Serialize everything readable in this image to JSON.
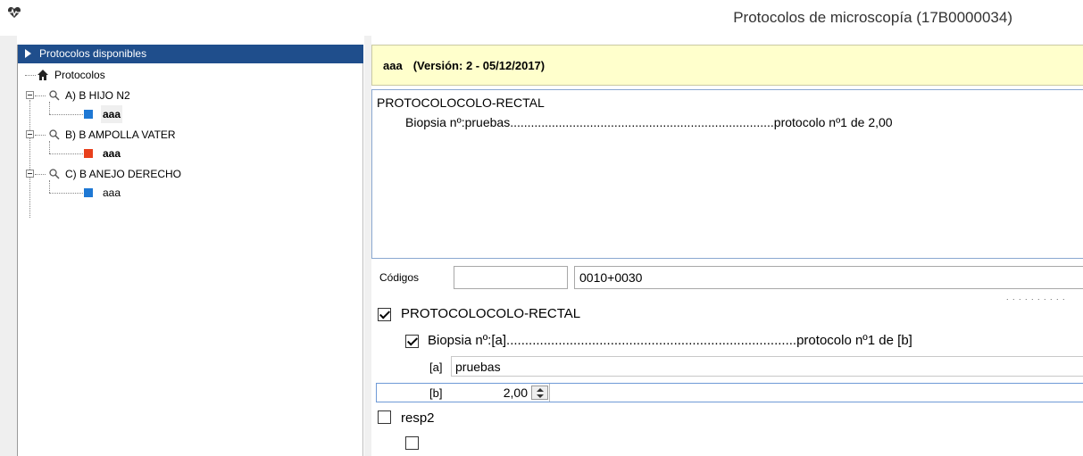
{
  "window": {
    "title": "Protocolos de microscopía (17B0000034)"
  },
  "tree": {
    "header": "Protocolos disponibles",
    "root": "Protocolos",
    "groups": [
      {
        "label": "A) B HIJO N2",
        "child": "aaa",
        "child_color": "#1e78d4",
        "child_bold": true
      },
      {
        "label": "B) B AMPOLLA VATER",
        "child": "aaa",
        "child_color": "#e8401c",
        "child_bold": true
      },
      {
        "label": "C) B ANEJO DERECHO",
        "child": "aaa",
        "child_color": "#1e78d4",
        "child_bold": false
      }
    ]
  },
  "protocol": {
    "name": "aaa",
    "version": "(Versión: 2 - 05/12/2017)"
  },
  "preview": {
    "line1": "PROTOCOLOCOLO-RECTAL",
    "line2": "Biopsia nº:pruebas............................................................................protocolo nº1 de 2,00"
  },
  "codes": {
    "label": "Códigos",
    "code1": "",
    "code2": "0010+0030"
  },
  "form": {
    "section": {
      "label": "PROTOCOLOCOLO-RECTAL",
      "checked": true
    },
    "item": {
      "label": "Biopsia nº:[a]..............................................................................protocolo nº1 de [b]",
      "checked": true
    },
    "param_a": {
      "tag": "[a]",
      "value": "pruebas"
    },
    "param_b": {
      "tag": "[b]",
      "value": "2,00"
    },
    "resp2": {
      "label": "resp2",
      "checked": false
    },
    "empty": {
      "label": "",
      "checked": false
    }
  },
  "colors": {
    "header_blue": "#1f4e8c",
    "header_yellow": "#ffffcc"
  }
}
